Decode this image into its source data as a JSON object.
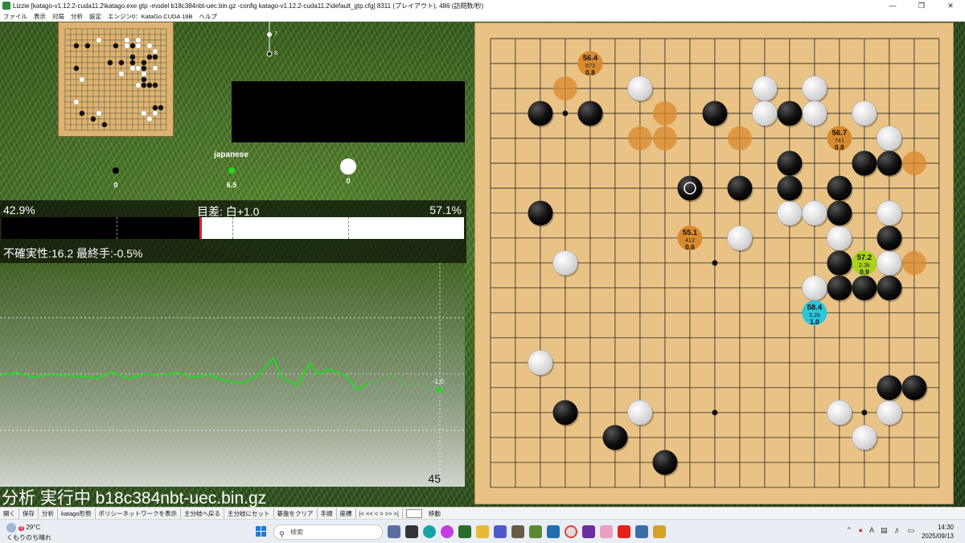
{
  "window": {
    "title": "Lizzie [katago-v1.12.2-cuda11.2\\katago.exe gtp -model b18c384nbt-uec.bin.gz -config katago-v1.12.2-cuda11.2\\default_gtp.cfg] 8311 (プレイアウト), 486 (訪問数/秒)",
    "minimize": "—",
    "maximize": "❐",
    "close": "✕"
  },
  "menu": [
    "ファイル",
    "表示",
    "対局",
    "分析",
    "設定",
    "エンジン0：KataGo CUDA 18B",
    "ヘルプ"
  ],
  "variation_tree": {
    "node_7": "7",
    "node_8": "8"
  },
  "status": {
    "rules": "japanese",
    "black_captures": "0",
    "komi": "6.5",
    "white_captures": "0"
  },
  "winrate": {
    "black": "42.9%",
    "white": "57.1%",
    "score_lead": "目差: 白+1.0",
    "black_fraction": 0.429
  },
  "uncertainty": "不確実性:16.2 最終手:-0.5%",
  "graph": {
    "current_label": "-1.0",
    "move_count": "45"
  },
  "analysis_status": "分析 実行中 b18c384nbt-uec.bin.gz",
  "candidates": [
    {
      "winrate": "56.4",
      "visits": "973",
      "score": "0.8"
    },
    {
      "winrate": "56.7",
      "visits": "741",
      "score": "0.8"
    },
    {
      "winrate": "55.1",
      "visits": "412",
      "score": "0.6"
    },
    {
      "winrate": "57.2",
      "visits": "2.3k",
      "score": "0.9"
    },
    {
      "winrate": "58.4",
      "visits": "3.2k",
      "score": "1.0"
    }
  ],
  "toolbar": {
    "buttons": [
      "開く",
      "保存",
      "分析",
      "katago形勢",
      "ポリシーネットワークを表示",
      "主分岐へ戻る",
      "主分岐にセット",
      "碁盤をクリア",
      "手順",
      "座標"
    ],
    "nav": "|< << < > >> >|",
    "goto": "移動"
  },
  "taskbar": {
    "temp": "29°C",
    "weather": "くもりのち晴れ",
    "badge": "9",
    "search_placeholder": "検索",
    "ime": "A",
    "time": "14:30",
    "date": "2025/09/13"
  },
  "colors": {
    "candidate_best": "#29c6dc",
    "candidate_second": "#a8d21e",
    "candidate_other": "#d98a2e",
    "winrate_line": "#1fdc1f",
    "last_move_marker": "#ffffff"
  }
}
